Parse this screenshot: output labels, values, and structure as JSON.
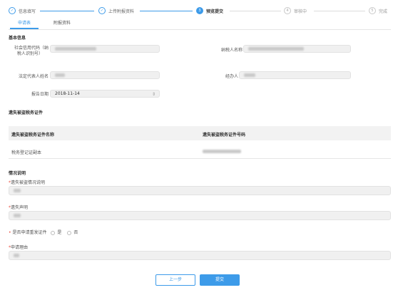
{
  "stepper": {
    "steps": [
      {
        "num": "1",
        "label": "信息填写",
        "state": "done"
      },
      {
        "num": "2",
        "label": "上传附报资料",
        "state": "done"
      },
      {
        "num": "3",
        "label": "预览提交",
        "state": "active"
      },
      {
        "num": "4",
        "label": "审核中",
        "state": "todo"
      },
      {
        "num": "5",
        "label": "完成",
        "state": "todo"
      }
    ],
    "done_glyph": "✓"
  },
  "tabs": [
    {
      "label": "申请表",
      "active": true
    },
    {
      "label": "附报资料",
      "active": false
    }
  ],
  "basic_info": {
    "title": "基本信息",
    "credit_code_label_line1": "社会信用代码（纳",
    "credit_code_label_line2": "税人识别号）",
    "taxpayer_name_label": "纳税人名称",
    "legal_rep_label": "法定代表人姓名",
    "handler_label": "经办人",
    "report_date_label": "报告日期",
    "report_date_value": "2018-11-14"
  },
  "table": {
    "title": "遗失被盗税务证件",
    "headers": [
      "遗失被盗税务证件名称",
      "遗失被盗税务证件号码"
    ],
    "rows": [
      [
        "税务登记证副本",
        ""
      ]
    ]
  },
  "situation": {
    "title": "情况说明",
    "loss_desc_label": "遗失被盗情况说明",
    "loss_statement_label": "遗失声明",
    "reissue_label": "是否申请重发证件",
    "reissue_yes": "是",
    "reissue_no": "否",
    "reason_label": "申请理由",
    "required_mark": "*",
    "bullet": "•"
  },
  "buttons": {
    "prev": "上一步",
    "submit": "提交"
  },
  "colors": {
    "accent": "#3d9be9",
    "required": "#e84a3b"
  }
}
